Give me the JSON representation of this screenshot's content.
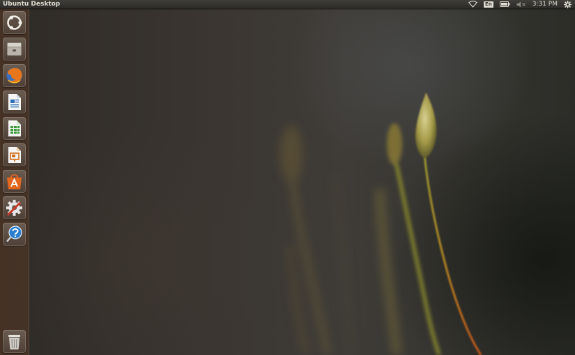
{
  "panel": {
    "title": "Ubuntu Desktop",
    "indicators": {
      "network_icon": "wifi-icon",
      "keyboard_layout": "En",
      "battery_icon": "battery-icon",
      "sound_icon": "volume-muted-icon",
      "clock": "3:31 PM",
      "session_icon": "gear-icon"
    }
  },
  "launcher": {
    "items": [
      {
        "icon": "dash-home-icon"
      },
      {
        "icon": "files-icon"
      },
      {
        "icon": "firefox-icon"
      },
      {
        "icon": "libreoffice-writer-icon"
      },
      {
        "icon": "libreoffice-calc-icon"
      },
      {
        "icon": "libreoffice-impress-icon"
      },
      {
        "icon": "software-center-icon"
      },
      {
        "icon": "system-settings-icon"
      },
      {
        "icon": "help-icon"
      },
      {
        "icon": "trash-icon"
      }
    ]
  },
  "colors": {
    "panel_bg": "#2c2b28",
    "launcher_bg": "#4a3426",
    "ubuntu_orange": "#dd4814"
  }
}
